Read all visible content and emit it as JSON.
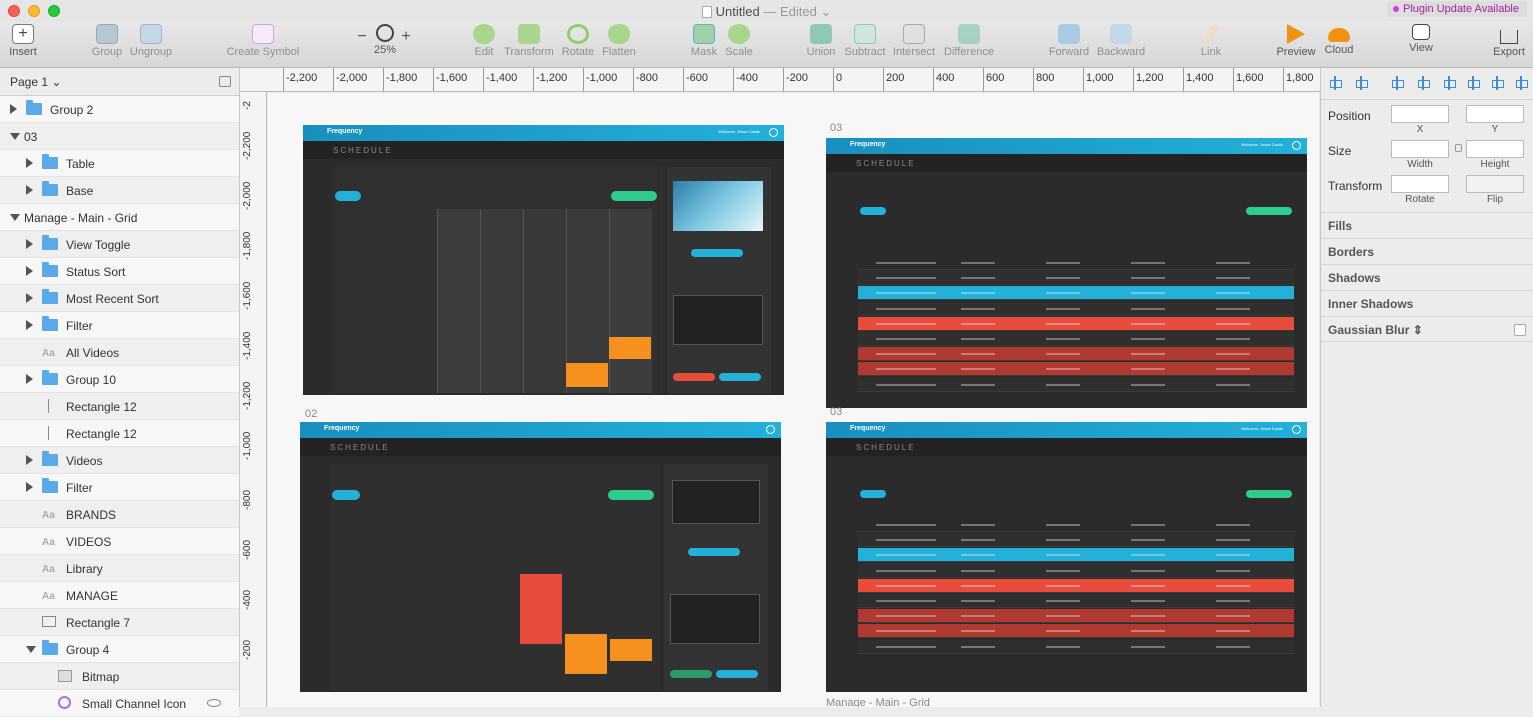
{
  "window": {
    "title": "Untitled",
    "edited": "— Edited",
    "plugin_update": "Plugin Update Available"
  },
  "toolbar": {
    "insert": "Insert",
    "group": "Group",
    "ungroup": "Ungroup",
    "create_symbol": "Create Symbol",
    "zoom_minus": "−",
    "zoom_plus": "+",
    "zoom": "25%",
    "edit": "Edit",
    "transform": "Transform",
    "rotate": "Rotate",
    "flatten": "Flatten",
    "mask": "Mask",
    "scale": "Scale",
    "union": "Union",
    "subtract": "Subtract",
    "intersect": "Intersect",
    "difference": "Difference",
    "forward": "Forward",
    "backward": "Backward",
    "link": "Link",
    "preview": "Preview",
    "cloud": "Cloud",
    "view": "View",
    "export": "Export"
  },
  "sidebar": {
    "page": "Page 1",
    "layers": [
      {
        "name": "Group 2",
        "icon": "folder-icon"
      },
      {
        "name": "03",
        "icon": "none"
      },
      {
        "name": "Table",
        "icon": "folder-icon"
      },
      {
        "name": "Base",
        "icon": "folder-icon"
      },
      {
        "name": "Manage - Main - Grid",
        "icon": "none"
      },
      {
        "name": "View Toggle",
        "icon": "folder-icon"
      },
      {
        "name": "Status Sort",
        "icon": "folder-icon"
      },
      {
        "name": "Most Recent Sort",
        "icon": "folder-icon"
      },
      {
        "name": "Filter",
        "icon": "folder-icon"
      },
      {
        "name": "All Videos",
        "icon": "text-icon",
        "glyph": "Aa"
      },
      {
        "name": "Group 10",
        "icon": "folder-icon"
      },
      {
        "name": "Rectangle 12",
        "icon": "line-icon"
      },
      {
        "name": "Rectangle 12",
        "icon": "line-icon"
      },
      {
        "name": "Videos",
        "icon": "folder-icon"
      },
      {
        "name": "Filter",
        "icon": "folder-icon"
      },
      {
        "name": "BRANDS",
        "icon": "text-icon",
        "glyph": "Aa"
      },
      {
        "name": "VIDEOS",
        "icon": "text-icon",
        "glyph": "Aa"
      },
      {
        "name": "Library",
        "icon": "text-icon",
        "glyph": "Aa"
      },
      {
        "name": "MANAGE",
        "icon": "text-icon",
        "glyph": "Aa"
      },
      {
        "name": "Rectangle 7",
        "icon": "rectangle-icon"
      },
      {
        "name": "Group 4",
        "icon": "folder-icon"
      },
      {
        "name": "Bitmap",
        "icon": "bitmap-icon"
      },
      {
        "name": "Small Channel Icon",
        "icon": "symbol-icon"
      }
    ]
  },
  "rulers": {
    "top": [
      "-2,200",
      "-2,000",
      "-1,800",
      "-1,600",
      "-1,400",
      "-1,200",
      "-1,000",
      "-800",
      "-600",
      "-400",
      "-200",
      "0",
      "200",
      "400",
      "600",
      "800",
      "1,000",
      "1,200",
      "1,400",
      "1,600",
      "1,800"
    ],
    "left": [
      "-2",
      "-2,200",
      "-2,000",
      "-1,800",
      "-1,600",
      "-1,400",
      "-1,200",
      "-1,000",
      "-800",
      "-600",
      "-400",
      "-200"
    ]
  },
  "artboards": {
    "a1": {
      "brand": "Frequency",
      "title": "SCHEDULE",
      "welcome": "Welcome, Jesse Castle"
    },
    "a2_label": "02",
    "a2": {
      "brand": "Frequency",
      "title": "SCHEDULE"
    },
    "a3_label": "03",
    "a3": {
      "brand": "Frequency",
      "title": "SCHEDULE",
      "welcome": "Welcome, Jesse Castle"
    },
    "a4_label": "03",
    "a4": {
      "brand": "Frequency",
      "title": "SCHEDULE",
      "welcome": "Welcome, Jesse Castle"
    },
    "bottom_label": "Manage - Main - Grid"
  },
  "inspector": {
    "position": "Position",
    "x": "X",
    "y": "Y",
    "size": "Size",
    "width": "Width",
    "height": "Height",
    "transform": "Transform",
    "rotate": "Rotate",
    "flip": "Flip",
    "fills": "Fills",
    "borders": "Borders",
    "shadows": "Shadows",
    "inner_shadows": "Inner Shadows",
    "gaussian_blur": "Gaussian Blur"
  },
  "colors": {
    "accent": "#23b0d9",
    "red_row": "#e74c3c",
    "dark_red_row": "#b03a30",
    "orange": "#f5901e",
    "green": "#2ecc8f"
  }
}
